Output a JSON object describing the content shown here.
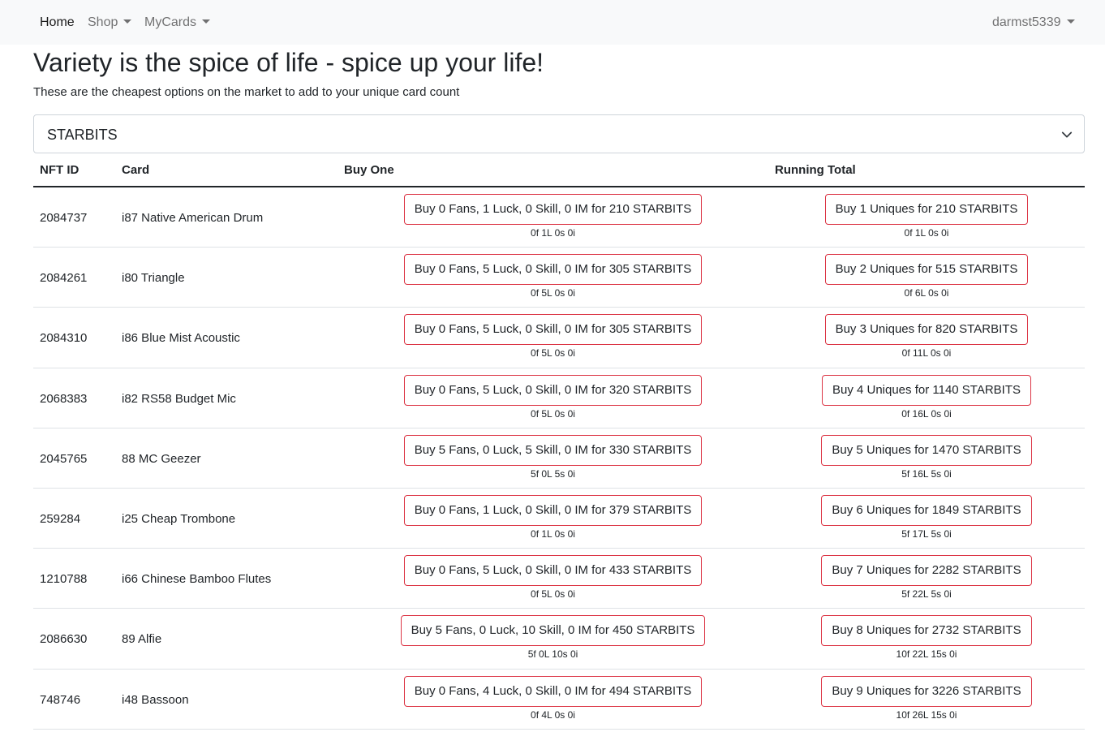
{
  "nav": {
    "home": "Home",
    "shop": "Shop",
    "mycards": "MyCards",
    "user": "darmst5339"
  },
  "page": {
    "title": "Variety is the spice of life - spice up your life!",
    "subtitle": "These are the cheapest options on the market to add to your unique card count"
  },
  "currency_select": {
    "value": "STARBITS"
  },
  "table": {
    "headers": {
      "nft_id": "NFT ID",
      "card": "Card",
      "buy_one": "Buy One",
      "running_total": "Running Total"
    },
    "rows": [
      {
        "nft_id": "2084737",
        "card": "i87 Native American Drum",
        "buy": "Buy 0 Fans, 1 Luck, 0 Skill, 0 IM for 210 STARBITS",
        "buy_stats": "0f 1L 0s 0i",
        "total": "Buy 1 Uniques for 210 STARBITS",
        "total_stats": "0f 1L 0s 0i"
      },
      {
        "nft_id": "2084261",
        "card": "i80 Triangle",
        "buy": "Buy 0 Fans, 5 Luck, 0 Skill, 0 IM for 305 STARBITS",
        "buy_stats": "0f 5L 0s 0i",
        "total": "Buy 2 Uniques for 515 STARBITS",
        "total_stats": "0f 6L 0s 0i"
      },
      {
        "nft_id": "2084310",
        "card": "i86 Blue Mist Acoustic",
        "buy": "Buy 0 Fans, 5 Luck, 0 Skill, 0 IM for 305 STARBITS",
        "buy_stats": "0f 5L 0s 0i",
        "total": "Buy 3 Uniques for 820 STARBITS",
        "total_stats": "0f 11L 0s 0i"
      },
      {
        "nft_id": "2068383",
        "card": "i82 RS58 Budget Mic",
        "buy": "Buy 0 Fans, 5 Luck, 0 Skill, 0 IM for 320 STARBITS",
        "buy_stats": "0f 5L 0s 0i",
        "total": "Buy 4 Uniques for 1140 STARBITS",
        "total_stats": "0f 16L 0s 0i"
      },
      {
        "nft_id": "2045765",
        "card": "88 MC Geezer",
        "buy": "Buy 5 Fans, 0 Luck, 5 Skill, 0 IM for 330 STARBITS",
        "buy_stats": "5f 0L 5s 0i",
        "total": "Buy 5 Uniques for 1470 STARBITS",
        "total_stats": "5f 16L 5s 0i"
      },
      {
        "nft_id": "259284",
        "card": "i25 Cheap Trombone",
        "buy": "Buy 0 Fans, 1 Luck, 0 Skill, 0 IM for 379 STARBITS",
        "buy_stats": "0f 1L 0s 0i",
        "total": "Buy 6 Uniques for 1849 STARBITS",
        "total_stats": "5f 17L 5s 0i"
      },
      {
        "nft_id": "1210788",
        "card": "i66 Chinese Bamboo Flutes",
        "buy": "Buy 0 Fans, 5 Luck, 0 Skill, 0 IM for 433 STARBITS",
        "buy_stats": "0f 5L 0s 0i",
        "total": "Buy 7 Uniques for 2282 STARBITS",
        "total_stats": "5f 22L 5s 0i"
      },
      {
        "nft_id": "2086630",
        "card": "89 Alfie",
        "buy": "Buy 5 Fans, 0 Luck, 10 Skill, 0 IM for 450 STARBITS",
        "buy_stats": "5f 0L 10s 0i",
        "total": "Buy 8 Uniques for 2732 STARBITS",
        "total_stats": "10f 22L 15s 0i"
      },
      {
        "nft_id": "748746",
        "card": "i48 Bassoon",
        "buy": "Buy 0 Fans, 4 Luck, 0 Skill, 0 IM for 494 STARBITS",
        "buy_stats": "0f 4L 0s 0i",
        "total": "Buy 9 Uniques for 3226 STARBITS",
        "total_stats": "10f 26L 15s 0i"
      }
    ]
  }
}
